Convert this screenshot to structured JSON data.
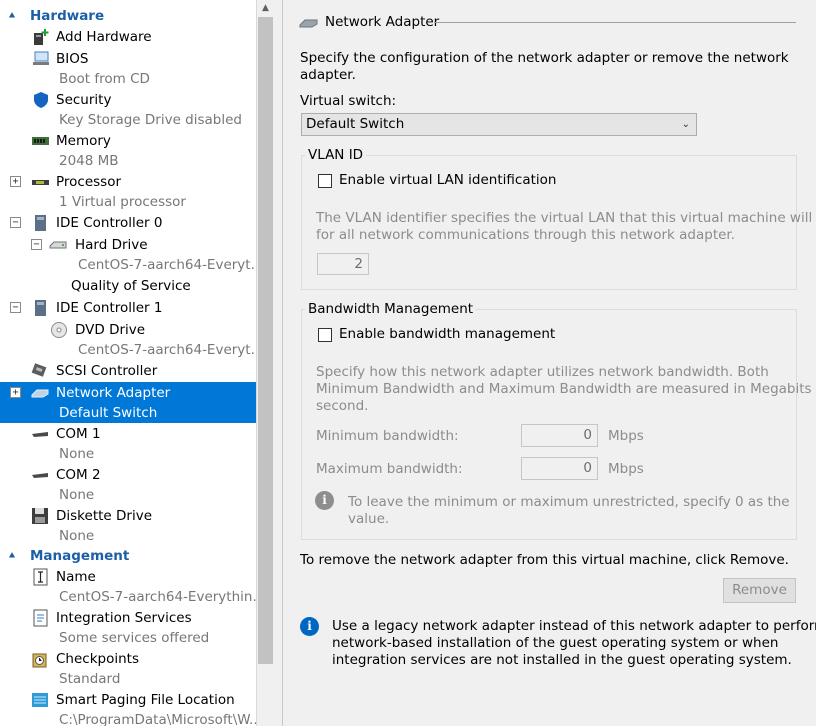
{
  "tree": {
    "hardware_section": "Hardware",
    "management_section": "Management",
    "hardware": [
      {
        "label": "Add Hardware",
        "sub": "",
        "icon": "add-hardware-icon"
      },
      {
        "label": "BIOS",
        "sub": "Boot from CD",
        "icon": "bios-icon"
      },
      {
        "label": "Security",
        "sub": "Key Storage Drive disabled",
        "icon": "shield-icon"
      },
      {
        "label": "Memory",
        "sub": "2048 MB",
        "icon": "memory-icon"
      },
      {
        "label": "Processor",
        "sub": "1 Virtual processor",
        "icon": "processor-icon"
      },
      {
        "label": "IDE Controller 0",
        "sub": "",
        "icon": "ide-controller-icon"
      },
      {
        "label": "Hard Drive",
        "sub": "CentOS-7-aarch64-Everyt...",
        "icon": "hard-drive-icon"
      },
      {
        "label": "Quality of Service",
        "sub": ""
      },
      {
        "label": "IDE Controller 1",
        "sub": "",
        "icon": "ide-controller-icon"
      },
      {
        "label": "DVD Drive",
        "sub": "CentOS-7-aarch64-Everyt...",
        "icon": "dvd-drive-icon"
      },
      {
        "label": "SCSI Controller",
        "sub": "",
        "icon": "scsi-controller-icon"
      },
      {
        "label": "Network Adapter",
        "sub": "Default Switch",
        "icon": "network-adapter-icon"
      },
      {
        "label": "COM 1",
        "sub": "None",
        "icon": "com-port-icon"
      },
      {
        "label": "COM 2",
        "sub": "None",
        "icon": "com-port-icon"
      },
      {
        "label": "Diskette Drive",
        "sub": "None",
        "icon": "diskette-icon"
      }
    ],
    "management": [
      {
        "label": "Name",
        "sub": "CentOS-7-aarch64-Everythin...",
        "icon": "name-icon"
      },
      {
        "label": "Integration Services",
        "sub": "Some services offered",
        "icon": "integration-services-icon"
      },
      {
        "label": "Checkpoints",
        "sub": "Standard",
        "icon": "checkpoints-icon"
      },
      {
        "label": "Smart Paging File Location",
        "sub": "C:\\ProgramData\\Microsoft\\W...",
        "icon": "smart-paging-icon"
      }
    ]
  },
  "panel": {
    "title": "Network Adapter",
    "description": "Specify the configuration of the network adapter or remove the network adapter.",
    "description_line1": "Specify the configuration of the network adapter or remove the network",
    "description_line2": "adapter.",
    "virtual_switch_label": "Virtual switch:",
    "virtual_switch_value": "Default Switch",
    "vlan": {
      "title": "VLAN ID",
      "checkbox_label": "Enable virtual LAN identification",
      "help_line1": "The VLAN identifier specifies the virtual LAN that this virtual machine will use",
      "help_line2": "for all network communications through this network adapter.",
      "value": "2"
    },
    "bandwidth": {
      "title": "Bandwidth Management",
      "checkbox_label": "Enable bandwidth management",
      "help_line1": "Specify how this network adapter utilizes network bandwidth. Both",
      "help_line2": "Minimum Bandwidth and Maximum Bandwidth are measured in Megabits per",
      "help_line3": "second.",
      "min_label": "Minimum bandwidth:",
      "min_value": "0",
      "max_label": "Maximum bandwidth:",
      "max_value": "0",
      "unit": "Mbps",
      "info_line1": "To leave the minimum or maximum unrestricted, specify 0 as the",
      "info_line2": "value."
    },
    "remove_text": "To remove the network adapter from this virtual machine, click Remove.",
    "remove_button": "Remove",
    "legacy_line1": "Use a legacy network adapter instead of this network adapter to perform a",
    "legacy_line2": "network-based installation of the guest operating system or when",
    "legacy_line3": "integration services are not installed in the guest operating system."
  },
  "colors": {
    "accent": "#0078d7",
    "section": "#1d5fa7",
    "info": "#0067c0"
  }
}
